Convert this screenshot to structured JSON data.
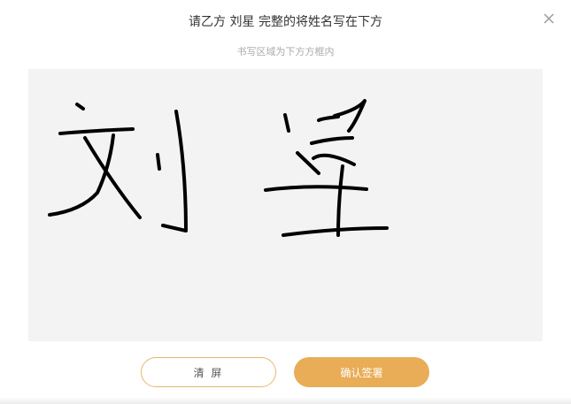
{
  "dialog": {
    "title": "请乙方 刘星 完整的将姓名写在下方",
    "subtitle": "书写区域为下方方框内",
    "close_icon": "close-icon",
    "signature_alt": "刘星"
  },
  "buttons": {
    "clear_label": "清 屏",
    "confirm_label": "确认签署"
  },
  "colors": {
    "accent": "#e8ad56",
    "accent_border": "#e8b66c",
    "canvas_bg": "#f3f3f3"
  }
}
